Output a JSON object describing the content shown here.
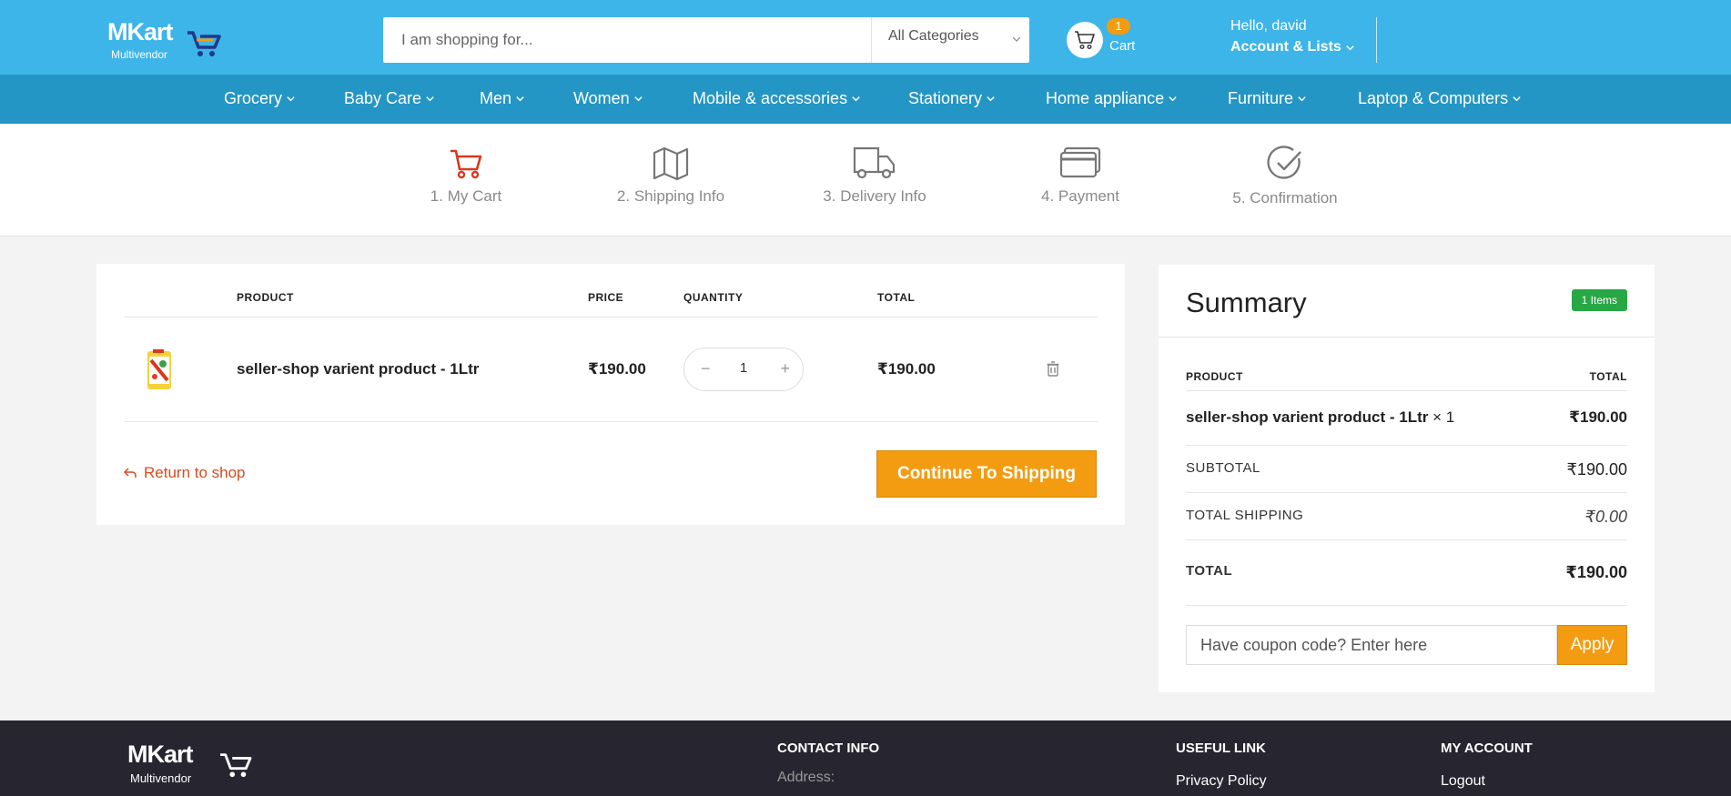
{
  "header": {
    "logo_title": "MKart",
    "logo_sub": "Multivendor",
    "search_placeholder": "I am shopping for...",
    "category_selected": "All Categories",
    "cart_count": "1",
    "cart_label": "Cart",
    "greeting": "Hello, david",
    "account_label": "Account & Lists"
  },
  "nav": [
    {
      "label": "Grocery"
    },
    {
      "label": "Baby Care"
    },
    {
      "label": "Men"
    },
    {
      "label": "Women"
    },
    {
      "label": "Mobile & accessories"
    },
    {
      "label": "Stationery"
    },
    {
      "label": "Home appliance"
    },
    {
      "label": "Furniture"
    },
    {
      "label": "Laptop & Computers"
    }
  ],
  "steps": [
    {
      "label": "1. My Cart",
      "icon": "cart-icon",
      "active": true
    },
    {
      "label": "2. Shipping Info",
      "icon": "map-icon"
    },
    {
      "label": "3. Delivery Info",
      "icon": "truck-icon"
    },
    {
      "label": "4. Payment",
      "icon": "card-icon"
    },
    {
      "label": "5. Confirmation",
      "icon": "check-circle-icon"
    }
  ],
  "cart": {
    "headers": {
      "product": "PRODUCT",
      "price": "PRICE",
      "quantity": "QUANTITY",
      "total": "TOTAL"
    },
    "items": [
      {
        "name": "seller-shop varient product - 1Ltr",
        "price": "₹190.00",
        "quantity": "1",
        "total": "₹190.00"
      }
    ],
    "return_label": "Return to shop",
    "continue_label": "Continue To Shipping"
  },
  "summary": {
    "title": "Summary",
    "items_badge": "1 Items",
    "headers": {
      "product": "PRODUCT",
      "total": "TOTAL"
    },
    "line_product": "seller-shop varient product - 1Ltr",
    "line_qty": " × 1",
    "line_total": "₹190.00",
    "subtotal_label": "SUBTOTAL",
    "subtotal_value": "₹190.00",
    "shipping_label": "TOTAL SHIPPING",
    "shipping_value": "₹0.00",
    "total_label": "TOTAL",
    "total_value": "₹190.00",
    "coupon_placeholder": "Have coupon code? Enter here",
    "apply_label": "Apply"
  },
  "footer": {
    "logo_title": "MKart",
    "logo_sub": "Multivendor",
    "contact_title": "CONTACT INFO",
    "address_label": "Address:",
    "useful_title": "USEFUL LINK",
    "useful_link_1": "Privacy Policy",
    "account_title": "MY ACCOUNT",
    "account_link_1": "Logout"
  },
  "colors": {
    "header_bg": "#3db5e8",
    "nav_bg": "#2496c5",
    "accent_orange": "#f39c12",
    "active_step": "#d9381e",
    "badge_green": "#28a745",
    "footer_bg": "#272530"
  }
}
